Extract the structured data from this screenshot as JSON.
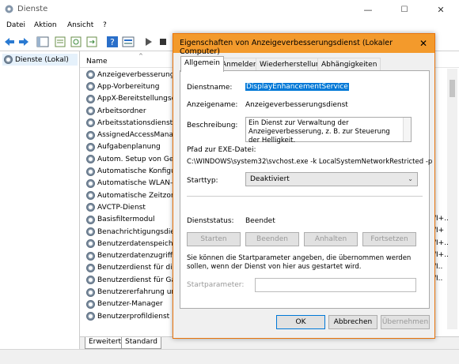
{
  "window": {
    "title": "Dienste",
    "minimize": "—",
    "maximize": "☐",
    "close": "✕"
  },
  "menu": [
    "Datei",
    "Aktion",
    "Ansicht",
    "?"
  ],
  "tree": {
    "root": "Dienste (Lokal)"
  },
  "list": {
    "column_name": "Name",
    "services": [
      "Anzeigeverbesserungsd",
      "App-Vorbereitung",
      "AppX-Bereitstellungsdi",
      "Arbeitsordner",
      "Arbeitsstationsdienst",
      "AssignedAccessManage",
      "Aufgabenplanung",
      "Autom. Setup von Gerä",
      "Automatische Konfigur",
      "Automatische WLAN-Ko",
      "Automatische Zeitzoner",
      "AVCTP-Dienst",
      "Basisfiltermodul",
      "Benachrichtigungsdienst",
      "Benutzerdatenspeicher",
      "Benutzerdatenzugriff_6",
      "Benutzerdienst für die B",
      "Benutzerdienst für Gam",
      "Benutzererfahrung und",
      "Benutzer-Manager",
      "Benutzerprofildienst"
    ],
    "right_edge_fragments": [
      "/I+..",
      "/I+",
      "/I+..",
      "/I+..",
      "/I..",
      "/I.."
    ]
  },
  "bottom_tabs": [
    "Erweitert",
    "Standard"
  ],
  "dialog": {
    "title": "Eigenschaften von Anzeigeverbesserungsdienst (Lokaler Computer)",
    "close": "✕",
    "tabs": [
      "Allgemein",
      "Anmelden",
      "Wiederherstellung",
      "Abhängigkeiten"
    ],
    "service_name_label": "Dienstname:",
    "service_name": "DisplayEnhancementService",
    "display_name_label": "Anzeigename:",
    "display_name": "Anzeigeverbesserungsdienst",
    "description_label": "Beschreibung:",
    "description": "Ein Dienst zur Verwaltung der Anzeigeverbesserung, z. B. zur Steuerung der Helligkeit.",
    "exe_path_label": "Pfad zur EXE-Datei:",
    "exe_path": "C:\\WINDOWS\\system32\\svchost.exe -k LocalSystemNetworkRestricted -p",
    "startup_type_label": "Starttyp:",
    "startup_type": "Deaktiviert",
    "status_label": "Dienststatus:",
    "status": "Beendet",
    "btn_start": "Starten",
    "btn_stop": "Beenden",
    "btn_pause": "Anhalten",
    "btn_resume": "Fortsetzen",
    "hint": "Sie können die Startparameter angeben, die übernommen werden sollen, wenn der Dienst von hier aus gestartet wird.",
    "param_label": "Startparameter:",
    "ok": "OK",
    "cancel": "Abbrechen",
    "apply": "Übernehmen"
  },
  "colors": {
    "dialog_title": "#f39a2c",
    "selection": "#0078d7"
  }
}
